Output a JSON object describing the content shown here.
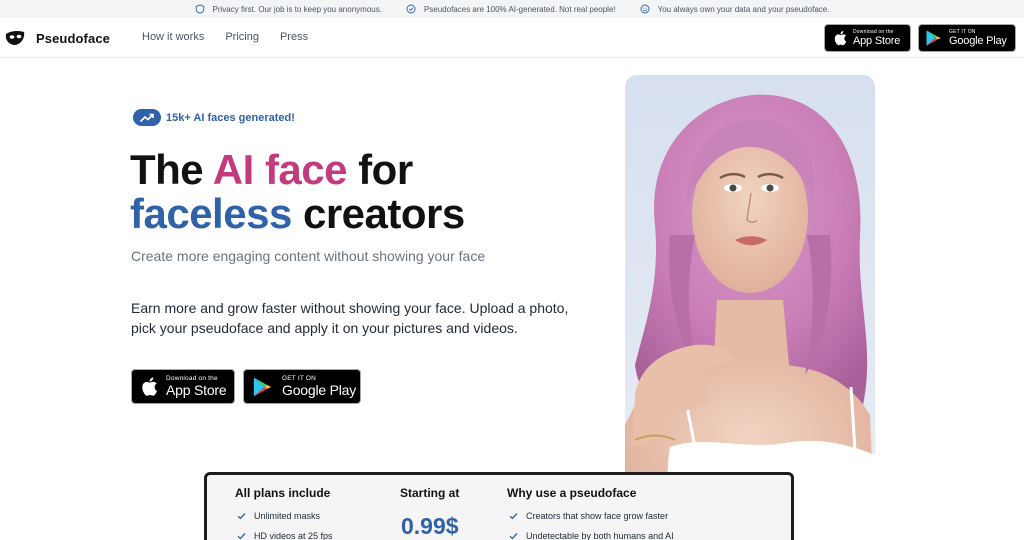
{
  "topbar": {
    "items": [
      {
        "icon": "shield-icon",
        "text": "Privacy first. Our job is to keep you anonymous."
      },
      {
        "icon": "check-circle-icon",
        "text": "Pseudofaces are 100% AI-generated. Not real people!"
      },
      {
        "icon": "smile-icon",
        "text": "You always own your data and your pseudoface."
      }
    ]
  },
  "nav": {
    "brand": "Pseudoface",
    "links": [
      "How it works",
      "Pricing",
      "Press"
    ]
  },
  "stores": {
    "apple_small": "Download on the",
    "apple_big": "App Store",
    "google_small": "GET IT ON",
    "google_big": "Google Play"
  },
  "hero": {
    "badge": "15k+ AI faces generated!",
    "headline": {
      "part1": "The ",
      "part2": "AI face",
      "part3": " for",
      "part4": "faceless",
      "part5": " creators"
    },
    "subtitle": "Create more engaging content without showing your face",
    "paragraph": "Earn more and grow faster without showing your face. Upload a photo, pick your pseudoface and apply it on your pictures and videos."
  },
  "plans": {
    "col1_title": "All plans include",
    "col1_items": [
      "Unlimited masks",
      "HD videos at 25 fps"
    ],
    "col2_title": "Starting at",
    "price": "0.99$",
    "col3_title": "Why use a pseudoface",
    "col3_items": [
      "Creators that show face grow faster",
      "Undetectable by both humans and AI"
    ]
  },
  "colors": {
    "accent_blue": "#2f62a8",
    "accent_pink": "#c23b7e"
  }
}
